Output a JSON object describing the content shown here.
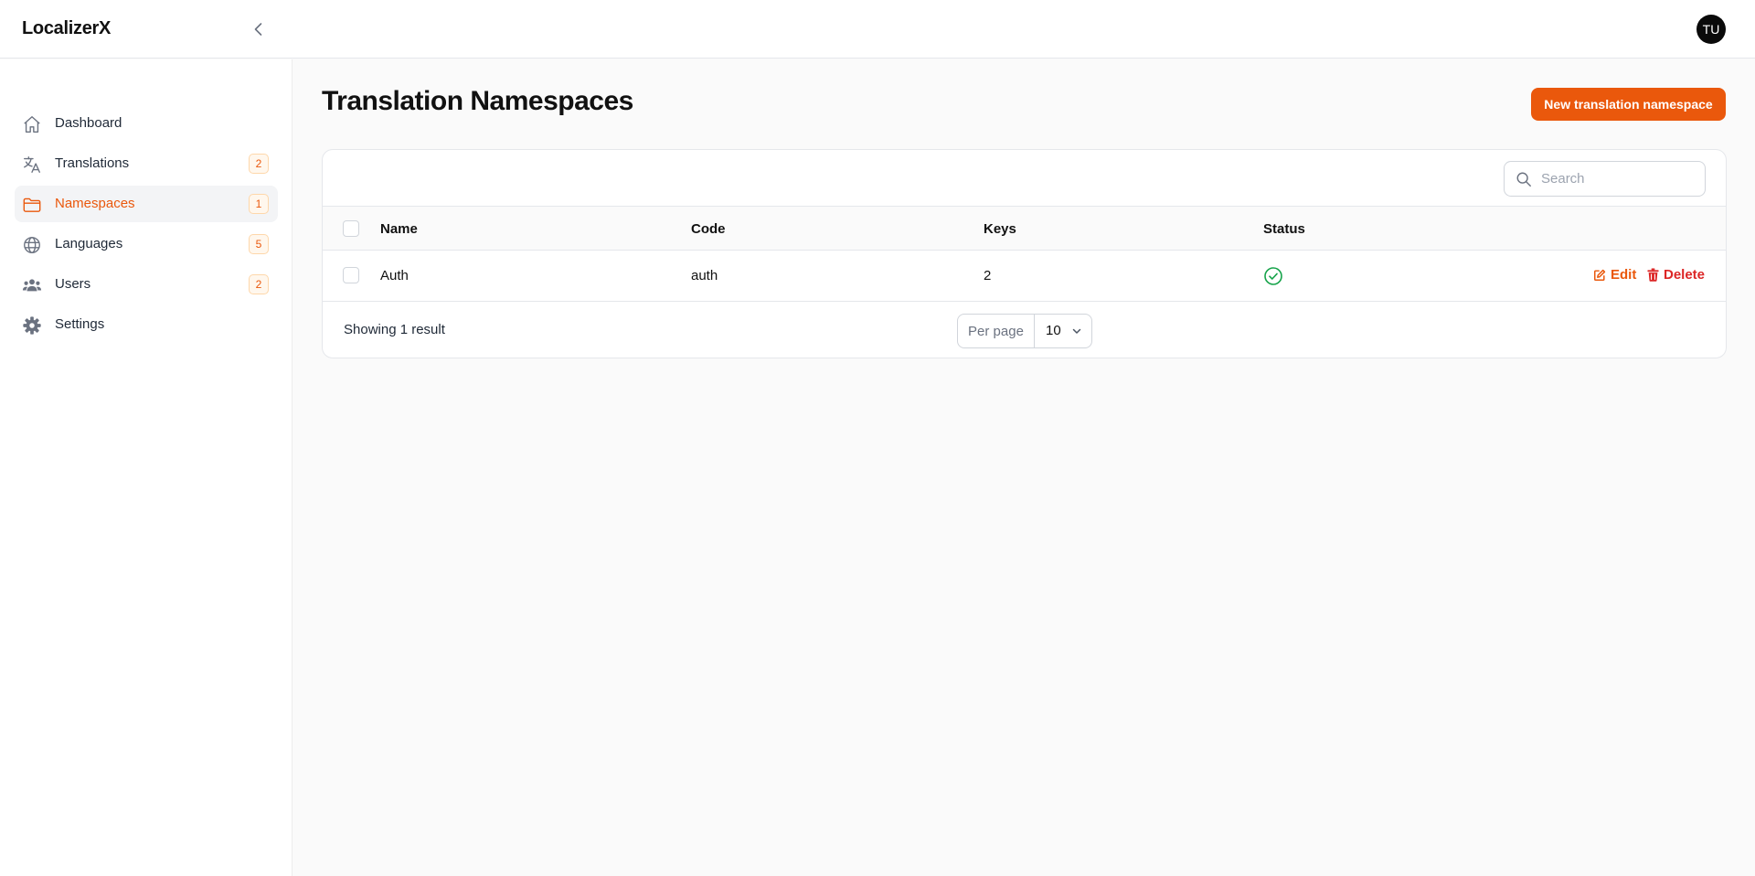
{
  "app": {
    "brand": "LocalizerX",
    "user_initials": "TU"
  },
  "sidebar": {
    "items": [
      {
        "label": "Dashboard",
        "icon": "home-icon",
        "badge": null,
        "active": false
      },
      {
        "label": "Translations",
        "icon": "translate-icon",
        "badge": "2",
        "active": false
      },
      {
        "label": "Namespaces",
        "icon": "folder-icon",
        "badge": "1",
        "active": true
      },
      {
        "label": "Languages",
        "icon": "globe-icon",
        "badge": "5",
        "active": false
      },
      {
        "label": "Users",
        "icon": "users-icon",
        "badge": "2",
        "active": false
      },
      {
        "label": "Settings",
        "icon": "gear-icon",
        "badge": null,
        "active": false
      }
    ]
  },
  "page": {
    "title": "Translation Namespaces",
    "new_button_label": "New translation namespace"
  },
  "search": {
    "placeholder": "Search",
    "value": ""
  },
  "table": {
    "columns": [
      "Name",
      "Code",
      "Keys",
      "Status"
    ],
    "rows": [
      {
        "name": "Auth",
        "code": "auth",
        "keys": "2",
        "status": "active"
      }
    ],
    "actions": {
      "edit": "Edit",
      "delete": "Delete"
    }
  },
  "pagination": {
    "summary": "Showing 1 result",
    "per_page_label": "Per page",
    "per_page_value": "10"
  },
  "colors": {
    "accent": "#ea580c",
    "danger": "#dc2626",
    "success": "#16a34a"
  }
}
